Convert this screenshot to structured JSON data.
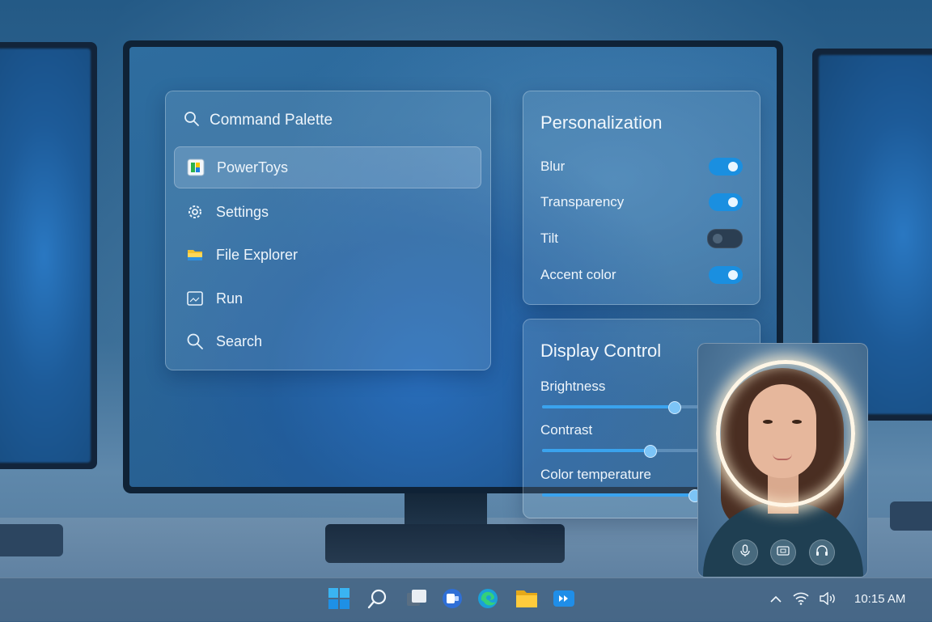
{
  "command_palette": {
    "search_label": "Command Palette",
    "items": [
      {
        "label": "PowerToys",
        "icon": "powertoys-icon",
        "selected": true
      },
      {
        "label": "Settings",
        "icon": "gear-icon",
        "selected": false
      },
      {
        "label": "File Explorer",
        "icon": "folder-icon",
        "selected": false
      },
      {
        "label": "Run",
        "icon": "run-icon",
        "selected": false
      },
      {
        "label": "Search",
        "icon": "search-icon",
        "selected": false
      }
    ]
  },
  "personalization": {
    "title": "Personalization",
    "toggles": [
      {
        "label": "Blur",
        "on": true
      },
      {
        "label": "Transparency",
        "on": true
      },
      {
        "label": "Tilt",
        "on": false
      },
      {
        "label": "Accent color",
        "on": true
      }
    ]
  },
  "display_control": {
    "title": "Display Control",
    "sliders": [
      {
        "label": "Brightness",
        "value": 0.65
      },
      {
        "label": "Contrast",
        "value": 0.53
      },
      {
        "label": "Color temperature",
        "value": 0.75
      }
    ]
  },
  "camera": {
    "buttons": [
      "microphone-icon",
      "screen-share-icon",
      "headset-icon"
    ]
  },
  "taskbar": {
    "apps": [
      "windows-start-icon",
      "search-icon",
      "task-view-icon",
      "chat-icon",
      "edge-icon",
      "file-explorer-icon",
      "media-player-icon"
    ],
    "tray": [
      "chevron-up-icon",
      "wifi-icon",
      "volume-icon"
    ],
    "clock": "10:15 AM"
  },
  "colors": {
    "accent": "#1a8fe0",
    "toggle_off": "#2b3e52",
    "glass_text": "#eef5fb"
  }
}
